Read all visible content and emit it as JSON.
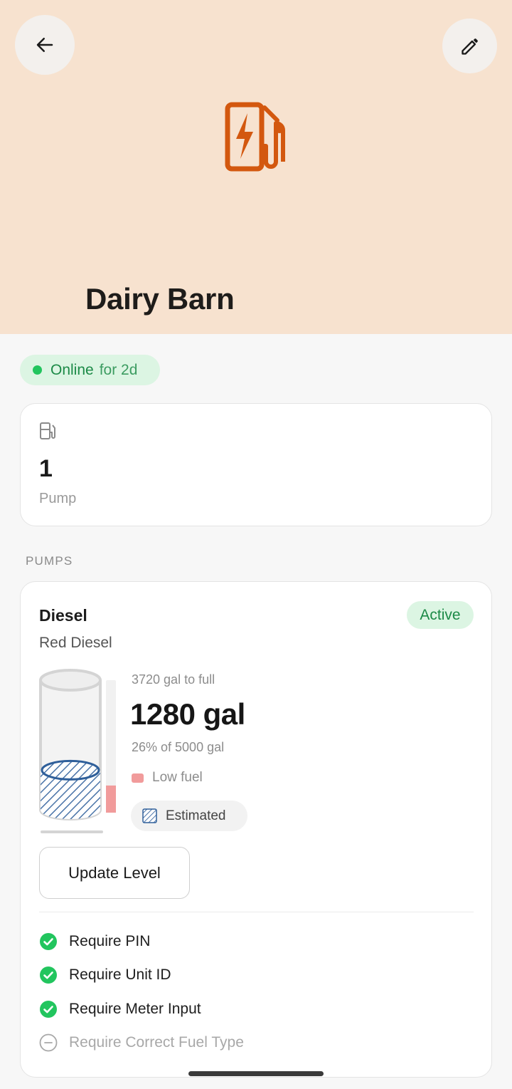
{
  "header": {
    "title": "Dairy Barn",
    "accent_color": "#d3580f",
    "back_icon": "arrow-left-icon",
    "edit_icon": "pencil-icon",
    "hero_icon": "ev-fuel-station-icon"
  },
  "status": {
    "label": "Online",
    "duration": "for 2d",
    "color": "#22c55e"
  },
  "summary": {
    "icon": "fuel-pump-icon",
    "count": "1",
    "label": "Pump"
  },
  "pumps_section_label": "PUMPS",
  "pump": {
    "name": "Diesel",
    "fuel_type": "Red Diesel",
    "status": "Active",
    "to_full": "3720 gal to full",
    "level": "1280 gal",
    "percent_text": "26% of 5000 gal",
    "level_fraction": 0.256,
    "low_fuel_label": "Low fuel",
    "low_fuel_color": "#f19b9b",
    "estimated_label": "Estimated",
    "update_button": "Update Level",
    "requirements": [
      {
        "label": "Require PIN",
        "enabled": true
      },
      {
        "label": "Require Unit ID",
        "enabled": true
      },
      {
        "label": "Require Meter Input",
        "enabled": true
      },
      {
        "label": "Require Correct Fuel Type",
        "enabled": false
      }
    ]
  }
}
